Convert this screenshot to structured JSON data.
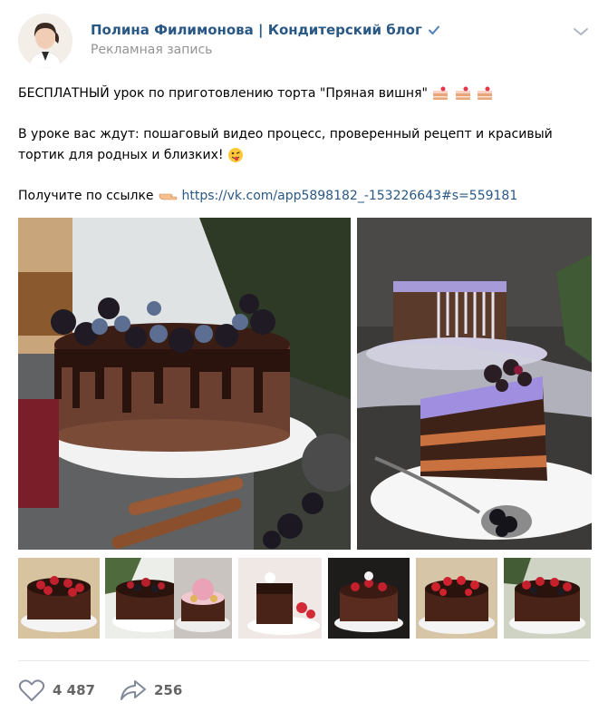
{
  "post": {
    "author": "Полина Филимонова | Кондитерский блог",
    "subtitle": "Рекламная запись",
    "line1": "БЕСПЛАТНЫЙ урок по приготовлению торта \"Пряная вишня\"",
    "line2": "В уроке вас ждут: пошаговый видео процесс, проверенный рецепт и красивый",
    "line3": "тортик для родных и близких!",
    "line4_prefix": "Получите по ссылке",
    "link": "https://vk.com/app5898182_-153226643#s=559181"
  },
  "stats": {
    "likes": "4 487",
    "shares": "256"
  },
  "icons": [
    "avatar",
    "verified-icon",
    "chevron-down-icon",
    "cake-emoji",
    "winking-tongue-emoji",
    "pointing-hand-emoji",
    "heart-icon",
    "share-arrow-icon"
  ],
  "colors": {
    "link": "#2a5885",
    "muted": "#939393",
    "divider": "#e7e8ec",
    "accent": "#5181b8"
  }
}
